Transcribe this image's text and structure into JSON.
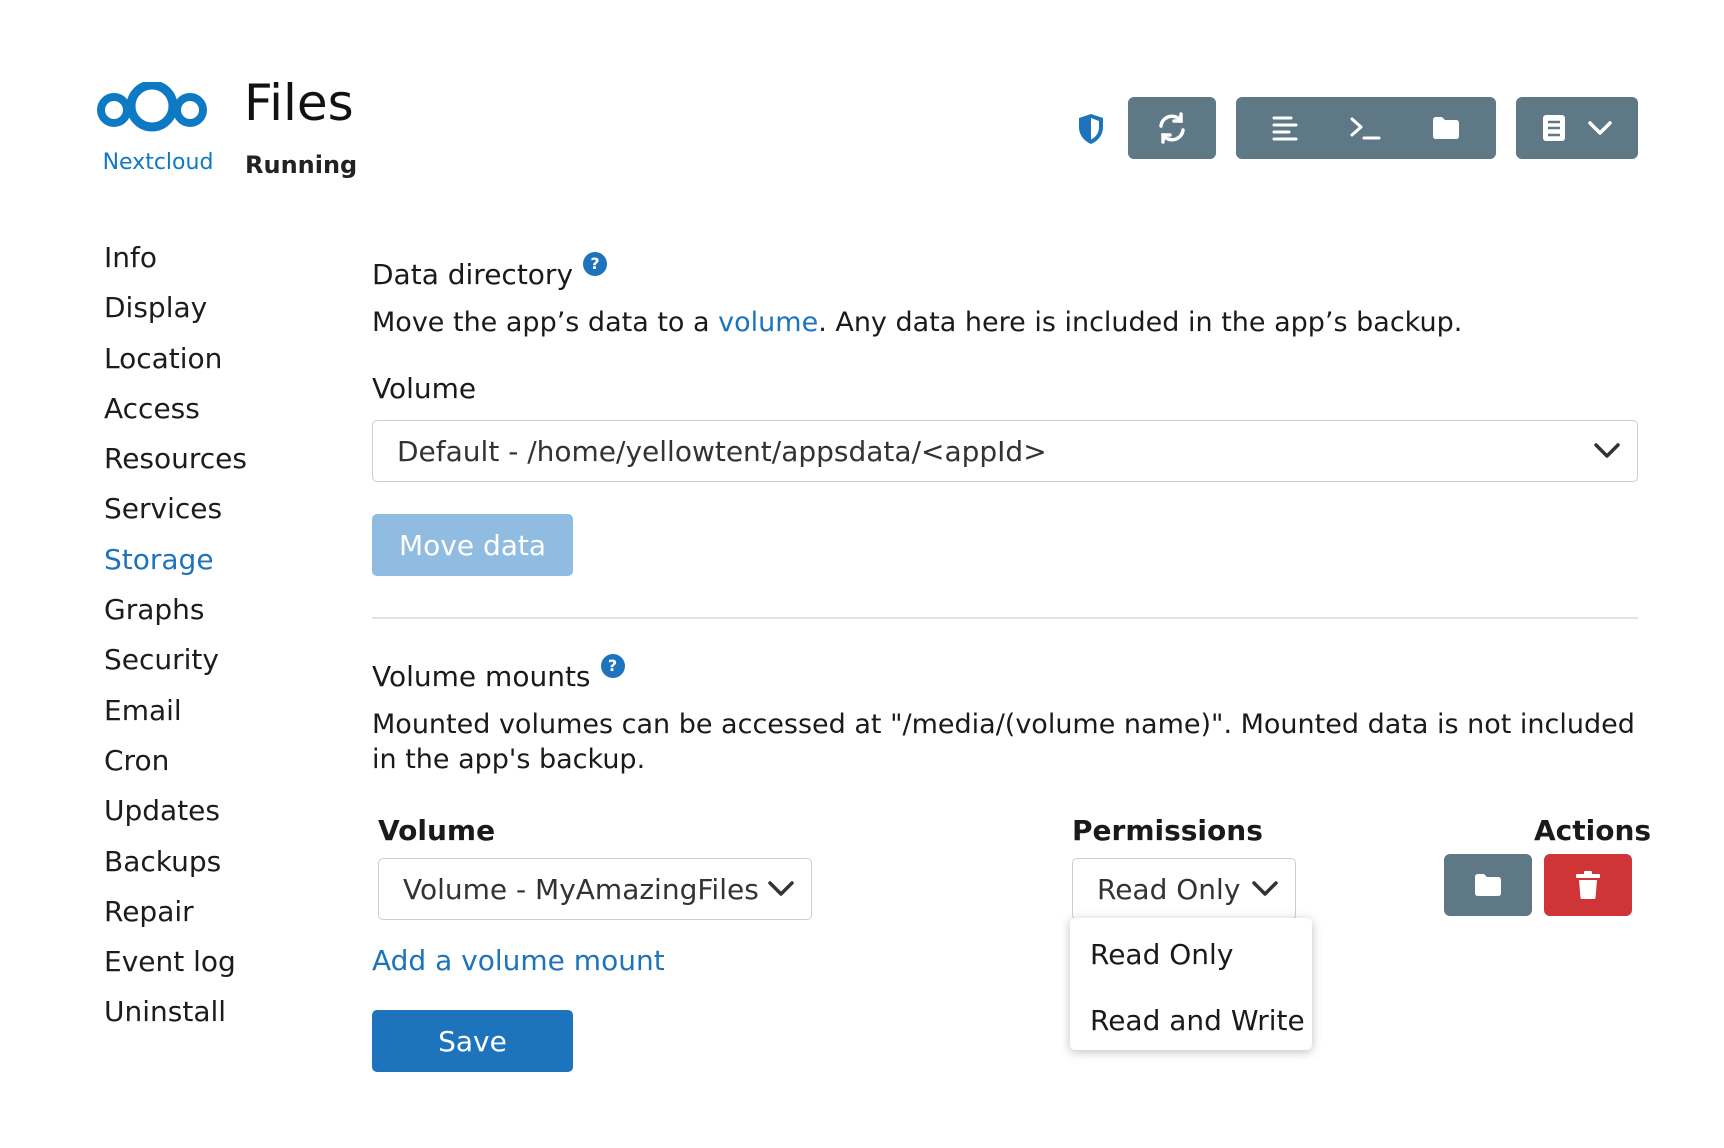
{
  "header": {
    "logo_text": "Nextcloud",
    "app_title": "Files",
    "app_status": "Running",
    "icons": {
      "security": "shield-icon",
      "restart": "refresh-icon",
      "logs": "logs-icon",
      "terminal": "terminal-icon",
      "files": "folder-icon",
      "docs": "book-icon",
      "docs_menu": "chevron-down-icon"
    }
  },
  "sidebar": {
    "items": [
      {
        "label": "Info"
      },
      {
        "label": "Display"
      },
      {
        "label": "Location"
      },
      {
        "label": "Access"
      },
      {
        "label": "Resources"
      },
      {
        "label": "Services"
      },
      {
        "label": "Storage",
        "active": true
      },
      {
        "label": "Graphs"
      },
      {
        "label": "Security"
      },
      {
        "label": "Email"
      },
      {
        "label": "Cron"
      },
      {
        "label": "Updates"
      },
      {
        "label": "Backups"
      },
      {
        "label": "Repair"
      },
      {
        "label": "Event log"
      },
      {
        "label": "Uninstall"
      }
    ]
  },
  "data_directory": {
    "title": "Data directory",
    "help": "?",
    "desc_before": "Move the app’s data to a ",
    "desc_link": "volume",
    "desc_after": ". Any data here is included in the app’s backup.",
    "volume_label": "Volume",
    "volume_value": "Default - /home/yellowtent/appsdata/<appId>",
    "move_button": "Move data"
  },
  "volume_mounts": {
    "title": "Volume mounts",
    "help": "?",
    "desc_line1": "Mounted volumes can be accessed at \"/media/(volume name)\". Mounted data is not included",
    "desc_line2": "in the app's backup.",
    "col_volume": "Volume",
    "col_permissions": "Permissions",
    "col_actions": "Actions",
    "mount": {
      "volume": "Volume - MyAmazingFiles",
      "permission": "Read Only"
    },
    "permission_options": [
      "Read Only",
      "Read and Write"
    ],
    "add_link": "Add a volume mount",
    "save_button": "Save"
  },
  "colors": {
    "accent": "#1d74bd",
    "toolbar_button": "#5e7886",
    "danger": "#cf3537",
    "disabled_button": "#90bce2"
  }
}
